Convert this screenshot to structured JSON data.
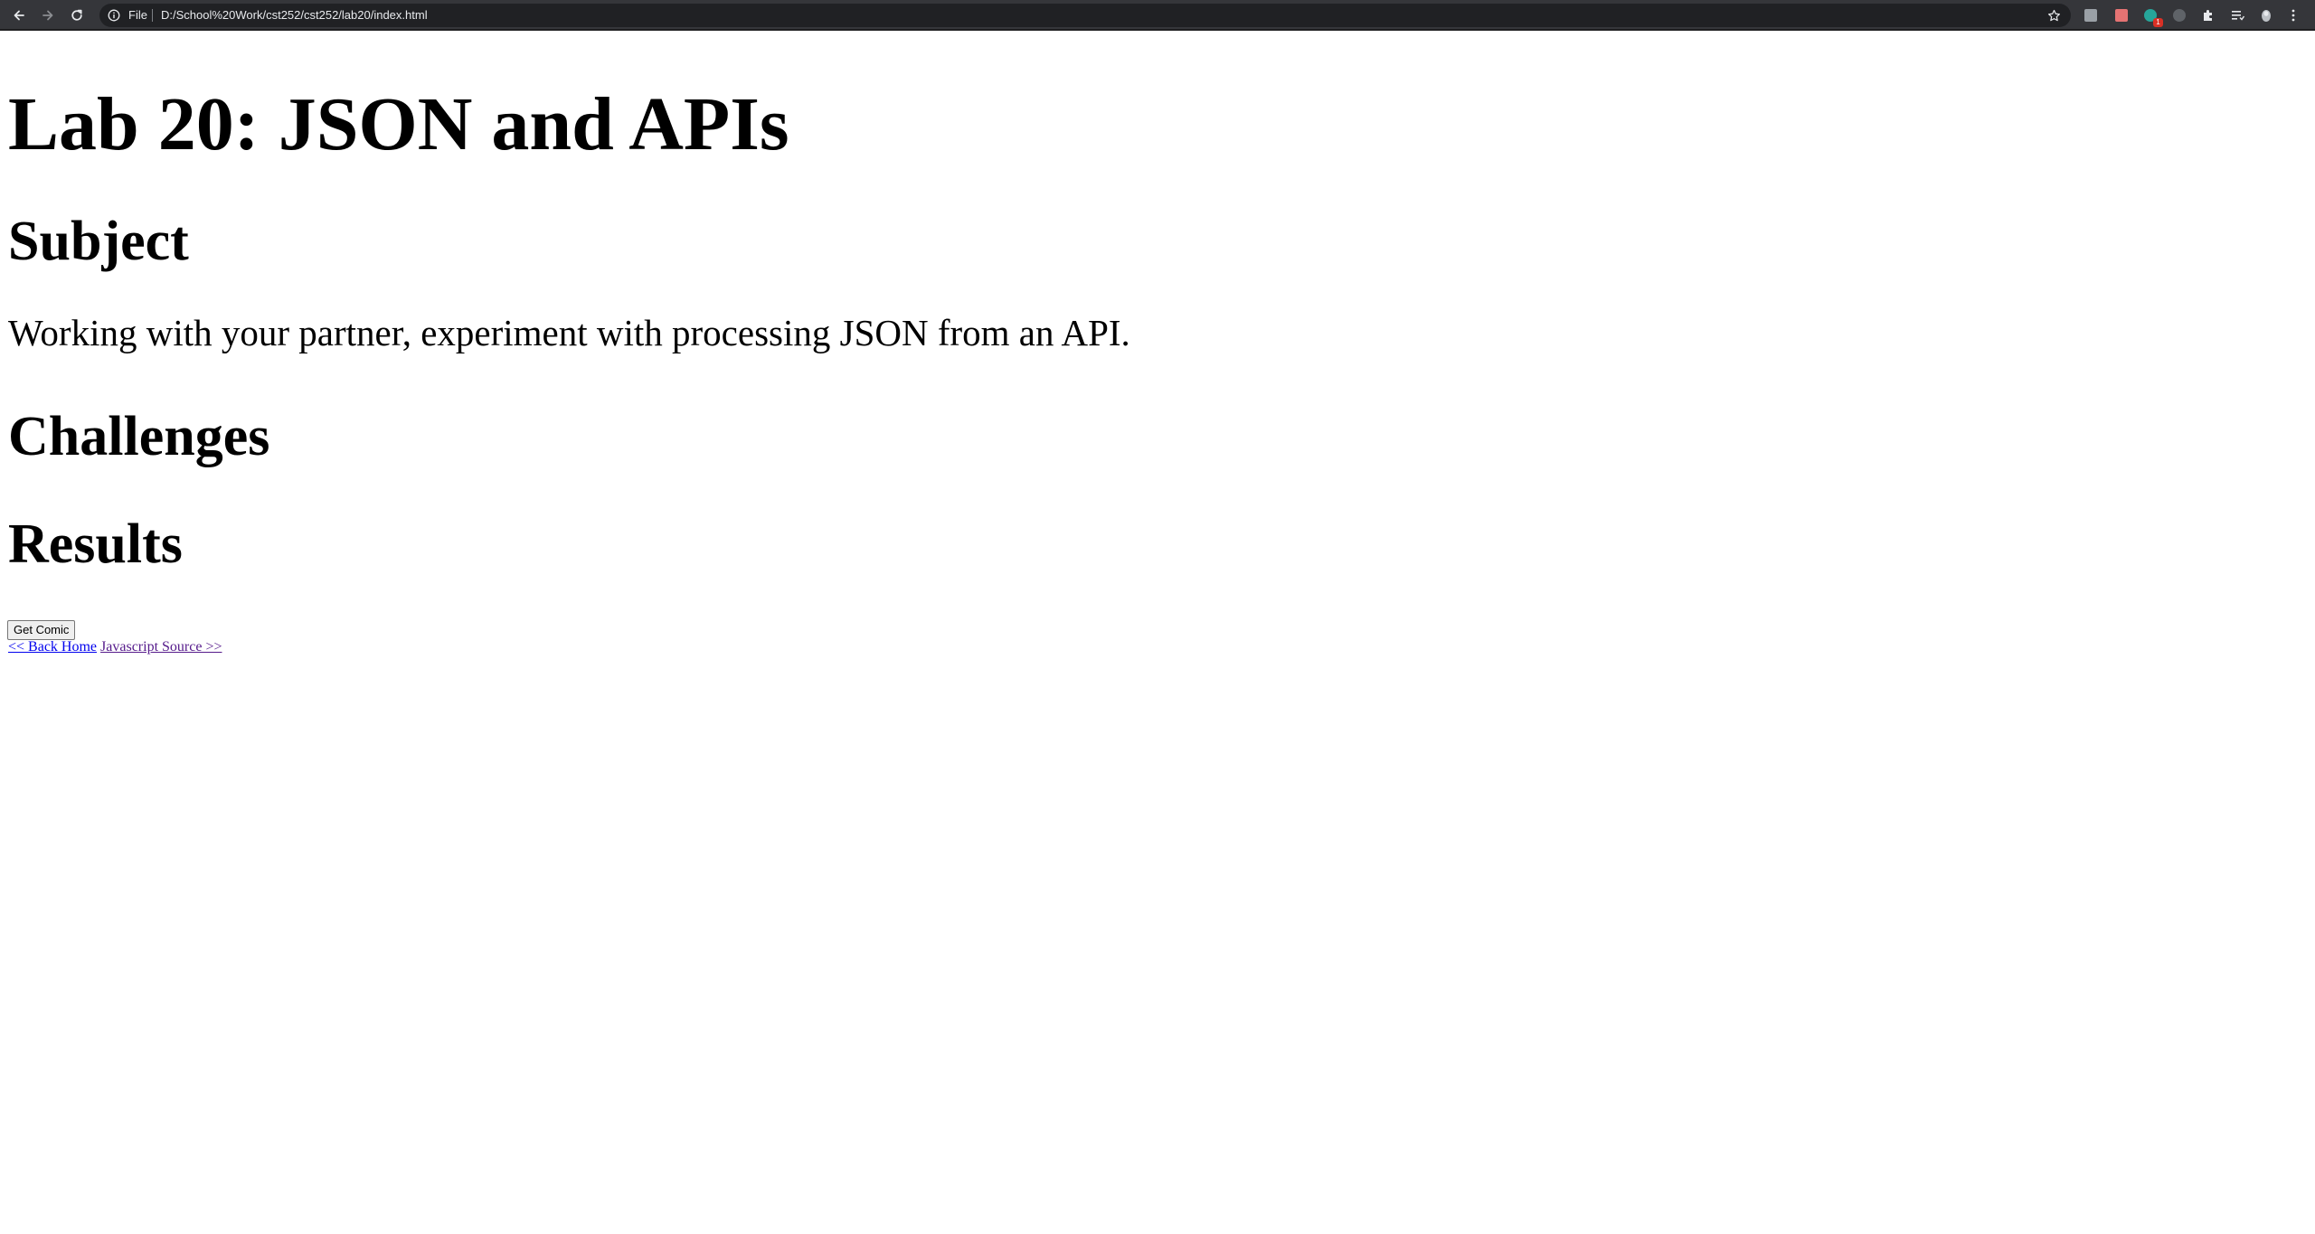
{
  "browser": {
    "address_bar": {
      "scheme_label": "File",
      "url": "D:/School%20Work/cst252/cst252/lab20/index.html"
    },
    "icons": {
      "back": "arrow-left-icon",
      "forward": "arrow-right-icon",
      "reload": "reload-icon",
      "info": "info-icon",
      "bookmark": "star-icon",
      "extensions": "puzzle-icon",
      "reading_list": "reading-list-icon",
      "profile": "avatar-icon",
      "menu": "three-dots-icon"
    },
    "extensions": [
      {
        "name": "extension-grey",
        "color": "#9aa0a6"
      },
      {
        "name": "extension-red",
        "color": "#e57373"
      },
      {
        "name": "extension-teal",
        "color": "#26a69a",
        "badge": "1"
      },
      {
        "name": "extension-dark",
        "color": "#5f6368"
      }
    ],
    "colors": {
      "toolbar": "#35363a",
      "omnibox": "#202124",
      "text": "#e8eaed"
    }
  },
  "page": {
    "title": "Lab 20: JSON and APIs",
    "subject_heading": "Subject",
    "subject_text": "Working with your partner, experiment with processing JSON from an API.",
    "challenges_heading": "Challenges",
    "results_heading": "Results",
    "get_comic_button": "Get Comic",
    "back_home_link": "<< Back Home",
    "javascript_source_link": "Javascript Source >>"
  }
}
